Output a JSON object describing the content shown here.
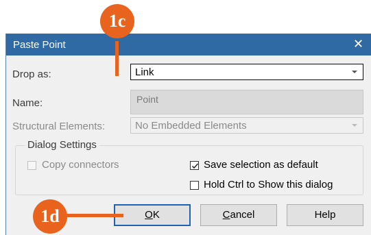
{
  "dialog": {
    "title": "Paste Point",
    "close_glyph": "✕"
  },
  "fields": {
    "drop_as": {
      "label": "Drop as:",
      "value": "Link"
    },
    "name": {
      "label": "Name:",
      "value": "Point"
    },
    "structural_elements": {
      "label": "Structural Elements:",
      "value": "No Embedded Elements"
    }
  },
  "dialog_settings": {
    "title": "Dialog Settings",
    "copy_connectors": {
      "label": "Copy connectors",
      "checked": false,
      "enabled": false
    },
    "save_selection": {
      "label": "Save selection as default",
      "checked": true,
      "enabled": true
    },
    "hold_ctrl": {
      "label": "Hold Ctrl to Show this dialog",
      "checked": false,
      "enabled": true
    }
  },
  "buttons": {
    "ok": {
      "mnemonic": "O",
      "rest": "K"
    },
    "cancel": {
      "mnemonic": "C",
      "rest": "ancel"
    },
    "help": {
      "label": "Help"
    }
  },
  "annotations": {
    "callout_1c": "1c",
    "callout_1d": "1d",
    "color": "#e8641e"
  }
}
